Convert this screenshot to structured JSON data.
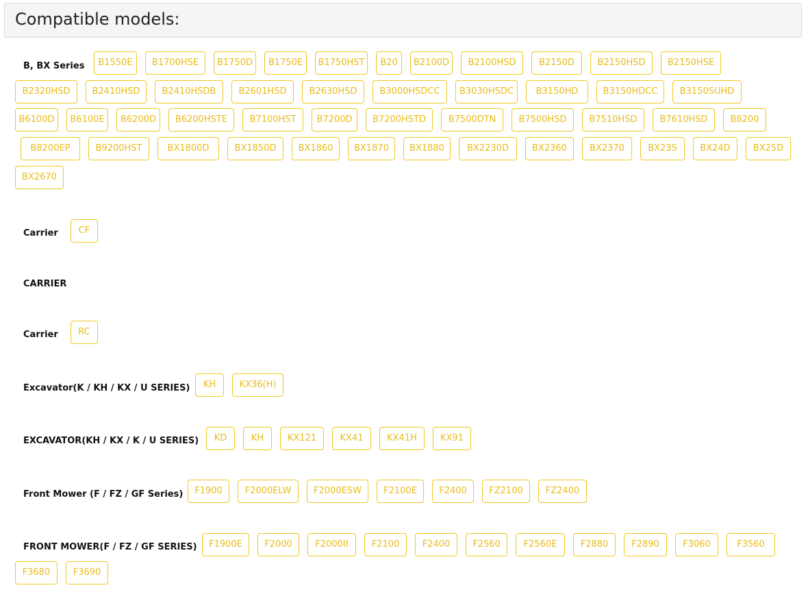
{
  "header": {
    "title": "Compatible models:"
  },
  "groups": [
    {
      "label": "B, BX Series",
      "models": [
        "B1550E",
        "B1700HSE",
        "B1750D",
        "B1750E",
        "B1750HST",
        "B20",
        "B2100D",
        "B2100HSD",
        "B2150D",
        "B2150HSD",
        "B2150HSE",
        "B2320HSD",
        "B2410HSD",
        "B2410HSDB",
        "B2601HSD",
        "B2630HSD",
        "B3000HSDCC",
        "B3030HSDC",
        "B3150HD",
        "B3150HDCC",
        "B3150SUHD",
        "B6100D",
        "B6100E",
        "B6200D",
        "B6200HSTE",
        "B7100HST",
        "B7200D",
        "B7200HSTD",
        "B7500DTN",
        "B7500HSD",
        "B7510HSD",
        "B7610HSD",
        "B8200",
        "B8200EP",
        "B9200HST",
        "BX1800D",
        "BX1850D",
        "BX1860",
        "BX1870",
        "BX1880",
        "BX2230D",
        "BX2360",
        "BX2370",
        "BX23S",
        "BX24D",
        "BX25D",
        "BX2670"
      ]
    },
    {
      "label": "Carrier",
      "models": [
        "CF"
      ]
    },
    {
      "label": "CARRIER",
      "models": []
    },
    {
      "label": "Carrier",
      "models": [
        "RC"
      ]
    },
    {
      "label": "Excavator(K / KH / KX / U SERIES)",
      "models": [
        "KH",
        "KX36(H)"
      ]
    },
    {
      "label": "EXCAVATOR(KH / KX / K / U SERIES)",
      "models": [
        "KD",
        "KH",
        "KX121",
        "KX41",
        "KX41H",
        "KX91"
      ]
    },
    {
      "label": "Front Mower (F / FZ / GF Series)",
      "models": [
        "F1900",
        "F2000ELW",
        "F2000ESW",
        "F2100E",
        "F2400",
        "FZ2100",
        "FZ2400"
      ]
    },
    {
      "label": "FRONT MOWER(F / FZ / GF SERIES)",
      "models": [
        "F1900E",
        "F2000",
        "F2000II",
        "F2100",
        "F2400",
        "F2560",
        "F2560E",
        "F2880",
        "F2890",
        "F3060",
        "F3560",
        "F3680",
        "F3690"
      ]
    }
  ]
}
